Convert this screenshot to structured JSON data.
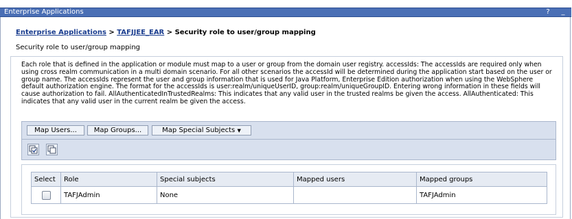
{
  "window": {
    "title": "Enterprise Applications",
    "help_label": "?",
    "close_label": "_"
  },
  "breadcrumb": {
    "link1": "Enterprise Applications",
    "sep1": " > ",
    "link2": "TAFJJEE_EAR",
    "sep2": " > ",
    "current": "Security role to user/group mapping"
  },
  "page": {
    "subtitle": "Security role to user/group mapping",
    "description": "Each role that is defined in the application or module must map to a user or group from the domain user registry. accessIds: The accessIds are required only when using cross realm communication in a multi domain scenario. For all other scenarios the accessId will be determined during the application start based on the user or group name. The accessIds represent the user and group information that is used for Java Platform, Enterprise Edition authorization when using the WebSphere default authorization engine. The format for the accessIds is user:realm/uniqueUserID, group:realm/uniqueGroupID. Entering wrong information in these fields will cause authorization to fail. AllAuthenticatedInTrustedRealms: This indicates that any valid user in the trusted realms be given the access. AllAuthenticated: This indicates that any valid user in the current realm be given the access."
  },
  "toolbar": {
    "map_users": "Map Users...",
    "map_groups": "Map Groups...",
    "map_special": "Map Special Subjects",
    "map_special_arrow": "▼",
    "select_all_icon": "select-all-icon",
    "deselect_all_icon": "deselect-all-icon"
  },
  "table": {
    "headers": [
      "Select",
      "Role",
      "Special subjects",
      "Mapped users",
      "Mapped groups"
    ],
    "rows": [
      {
        "role": "TAFJAdmin",
        "special": "None",
        "users": "",
        "groups": "TAFJAdmin"
      }
    ]
  }
}
